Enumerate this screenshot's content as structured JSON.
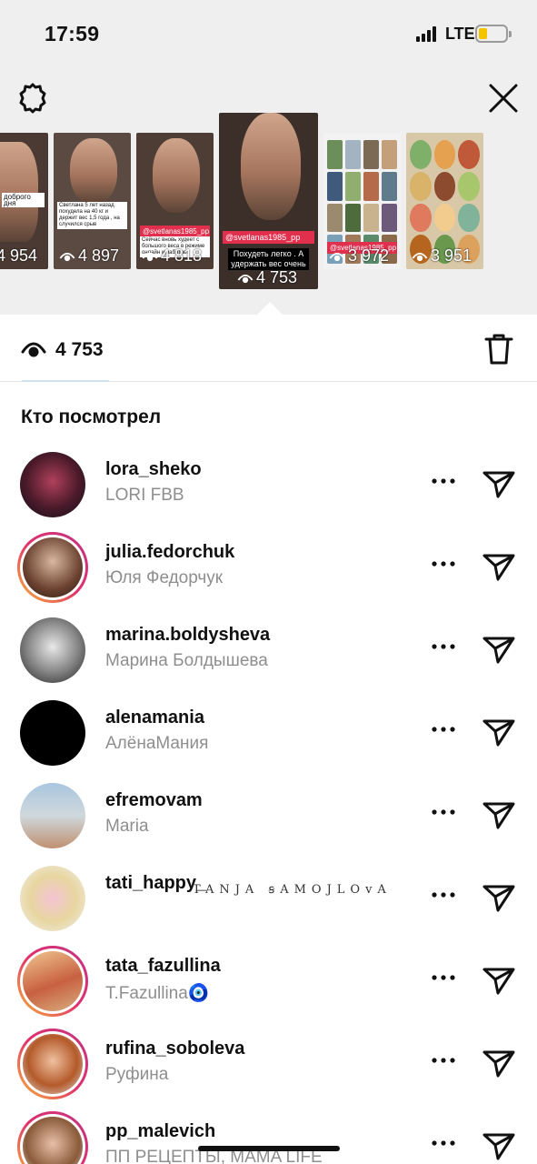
{
  "status_bar": {
    "time": "17:59",
    "network": "LTE",
    "battery_level": 0.3,
    "battery_color": "#f4c400"
  },
  "header": {
    "settings_icon": "gear-icon",
    "close_icon": "close-icon"
  },
  "stories": [
    {
      "views": "4 954",
      "caption": "доброго дня"
    },
    {
      "views": "4 897",
      "caption": "Светлана 5 лет назад похудела на 40 кг и держит вес 1,5 года , на случился срыв"
    },
    {
      "views": "4 818",
      "tag": "@svetlanas1985_pp",
      "caption": "Сейчас вновь худеет с большого веса в режиме онлайн и работает"
    },
    {
      "views": "4 753",
      "tag": "@svetlanas1985_pp",
      "caption": "Похудеть легко . А удержать вес очень",
      "selected": true
    },
    {
      "views": "3 972",
      "tag": "@svetlanas1985_pp"
    },
    {
      "views": "3 951"
    }
  ],
  "summary": {
    "view_count": "4 753",
    "delete_icon": "trash-icon"
  },
  "section_title": "Кто посмотрел",
  "viewers": [
    {
      "username": "lora_sheko",
      "full_name": "LORI FBB",
      "story_ring": false
    },
    {
      "username": "julia.fedorchuk",
      "full_name": "Юля Федорчук",
      "story_ring": true
    },
    {
      "username": "marina.boldysheva",
      "full_name": "Марина Болдышева",
      "story_ring": false
    },
    {
      "username": "alenamania",
      "full_name": "АлёнаМания",
      "story_ring": false
    },
    {
      "username": "efremovam",
      "full_name": "Maria",
      "story_ring": false
    },
    {
      "username": "tati_happy_",
      "full_name": "",
      "decor_text": "TANJA ꞩAMOJLOvA",
      "story_ring": false
    },
    {
      "username": "tata_fazullina",
      "full_name": "T.Fazullina🧿",
      "story_ring": true
    },
    {
      "username": "rufina_soboleva",
      "full_name": "Руфина",
      "story_ring": true
    },
    {
      "username": "pp_malevich",
      "full_name": "ПП РЕЦЕПТЫ, MAMA LIFE",
      "story_ring": true
    }
  ],
  "colors": {
    "ring_gradient": [
      "#f7b733",
      "#e1306c",
      "#c13584"
    ],
    "background_top": "#efefef",
    "secondary_text": "#8e8e8e"
  }
}
